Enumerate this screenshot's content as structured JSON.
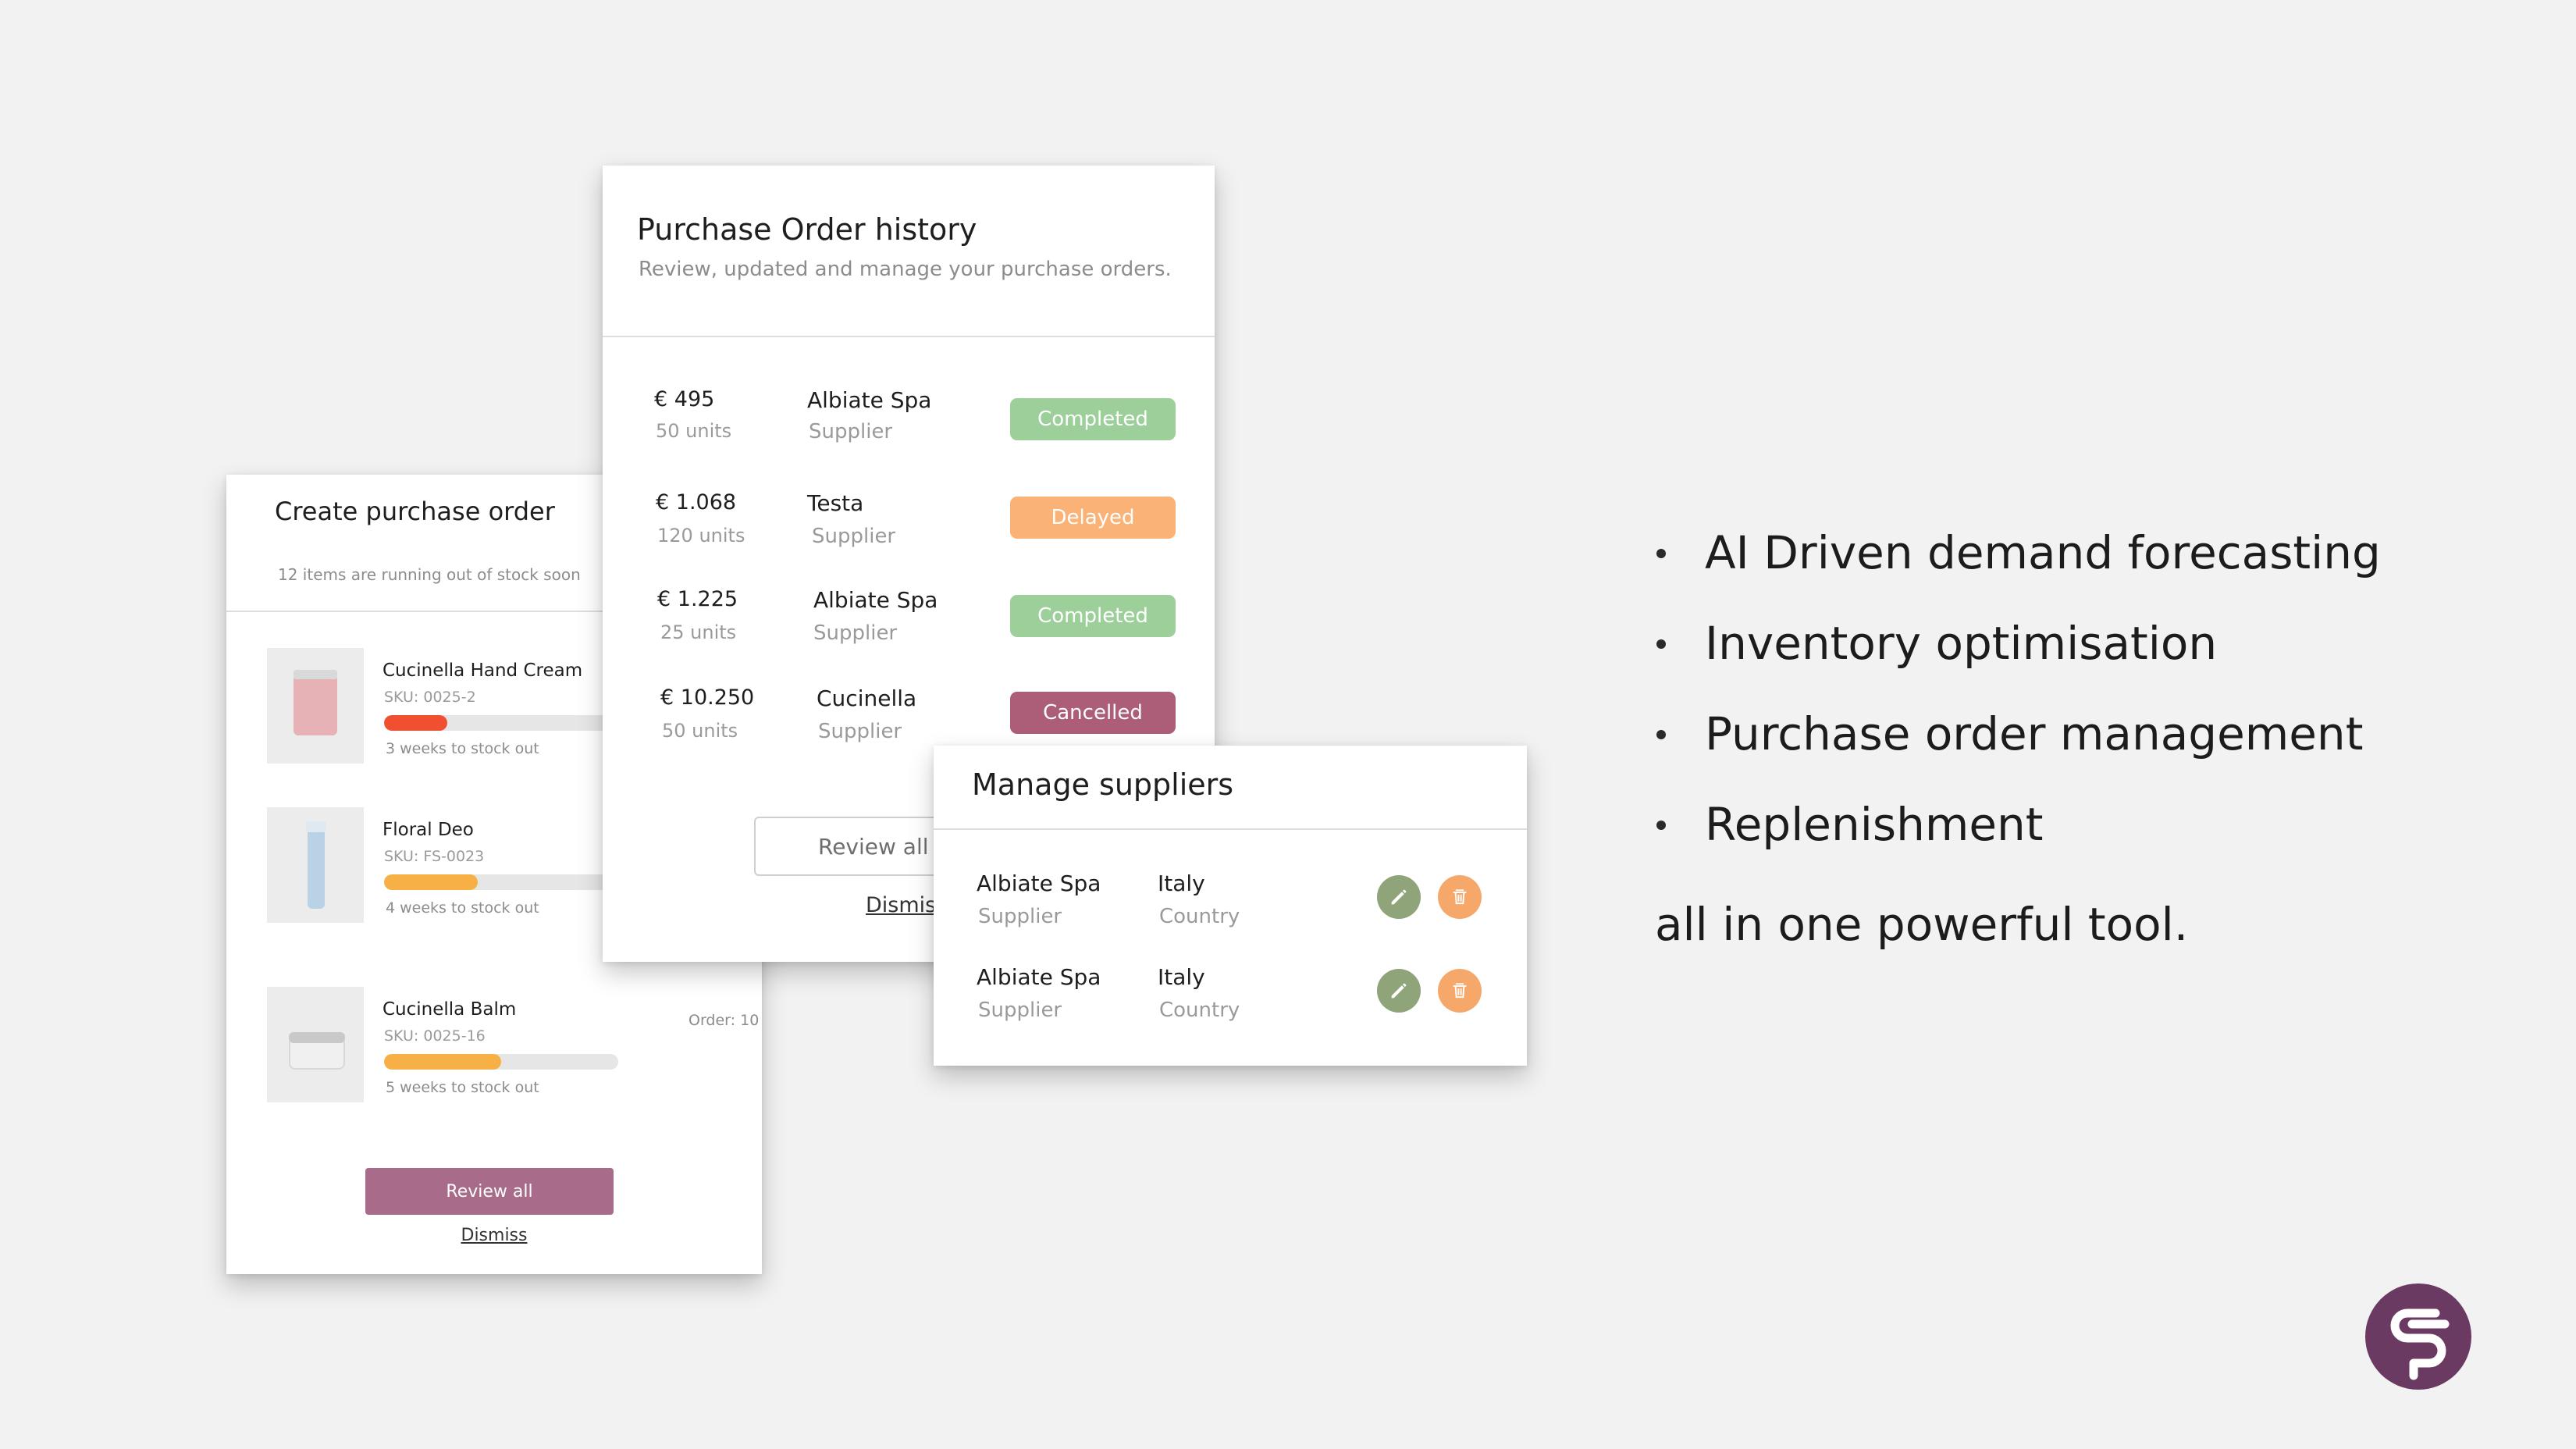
{
  "create_order": {
    "title": "Create purchase order",
    "subtitle": "12 items are running out of stock soon",
    "items": [
      {
        "name": "Cucinella Hand Cream",
        "sku": "SKU: 0025-2",
        "stock_level": 0.27,
        "bar_color": "#f0502f",
        "caption": "3 weeks to stock out"
      },
      {
        "name": "Floral Deo",
        "sku": "SKU: FS-0023",
        "stock_level": 0.4,
        "bar_color": "#f7b046",
        "caption": "4 weeks to stock out"
      },
      {
        "name": "Cucinella Balm",
        "sku": "SKU: 0025-16",
        "stock_level": 0.5,
        "bar_color": "#f7b046",
        "caption": "5 weeks to stock out",
        "order_label": "Order:  10"
      }
    ],
    "review_all": "Review all",
    "dismiss": "Dismiss"
  },
  "po_history": {
    "title": "Purchase Order history",
    "subtitle": "Review, updated and manage your purchase orders.",
    "orders": [
      {
        "amount": "€ 495",
        "units": "50 units",
        "supplier": "Albiate Spa",
        "role": "Supplier",
        "status": "Completed",
        "status_color": "#9ccf9a"
      },
      {
        "amount": "€ 1.068",
        "units": "120 units",
        "supplier": "Testa",
        "role": "Supplier",
        "status": "Delayed",
        "status_color": "#fbb277"
      },
      {
        "amount": "€ 1.225",
        "units": "25 units",
        "supplier": "Albiate Spa",
        "role": "Supplier",
        "status": "Completed",
        "status_color": "#9ccf9a"
      },
      {
        "amount": "€ 10.250",
        "units": "50 units",
        "supplier": "Cucinella",
        "role": "Supplier",
        "status": "Cancelled",
        "status_color": "#ac5d78"
      }
    ],
    "review_all": "Review all",
    "dismiss": "Dismiss"
  },
  "suppliers": {
    "title": "Manage suppliers",
    "rows": [
      {
        "name": "Albiate Spa",
        "role": "Supplier",
        "country": "Italy",
        "country_label": "Country"
      },
      {
        "name": "Albiate Spa",
        "role": "Supplier",
        "country": "Italy",
        "country_label": "Country"
      }
    ],
    "edit_icon": "pencil-icon",
    "delete_icon": "trash-icon"
  },
  "features": {
    "bullets": [
      "AI Driven demand forecasting",
      "Inventory optimisation",
      "Purchase order management",
      "Replenishment"
    ],
    "tagline": "all in one powerful tool."
  },
  "brand": {
    "logo_icon": "brand-logo",
    "logo_color": "#6b3a63"
  }
}
